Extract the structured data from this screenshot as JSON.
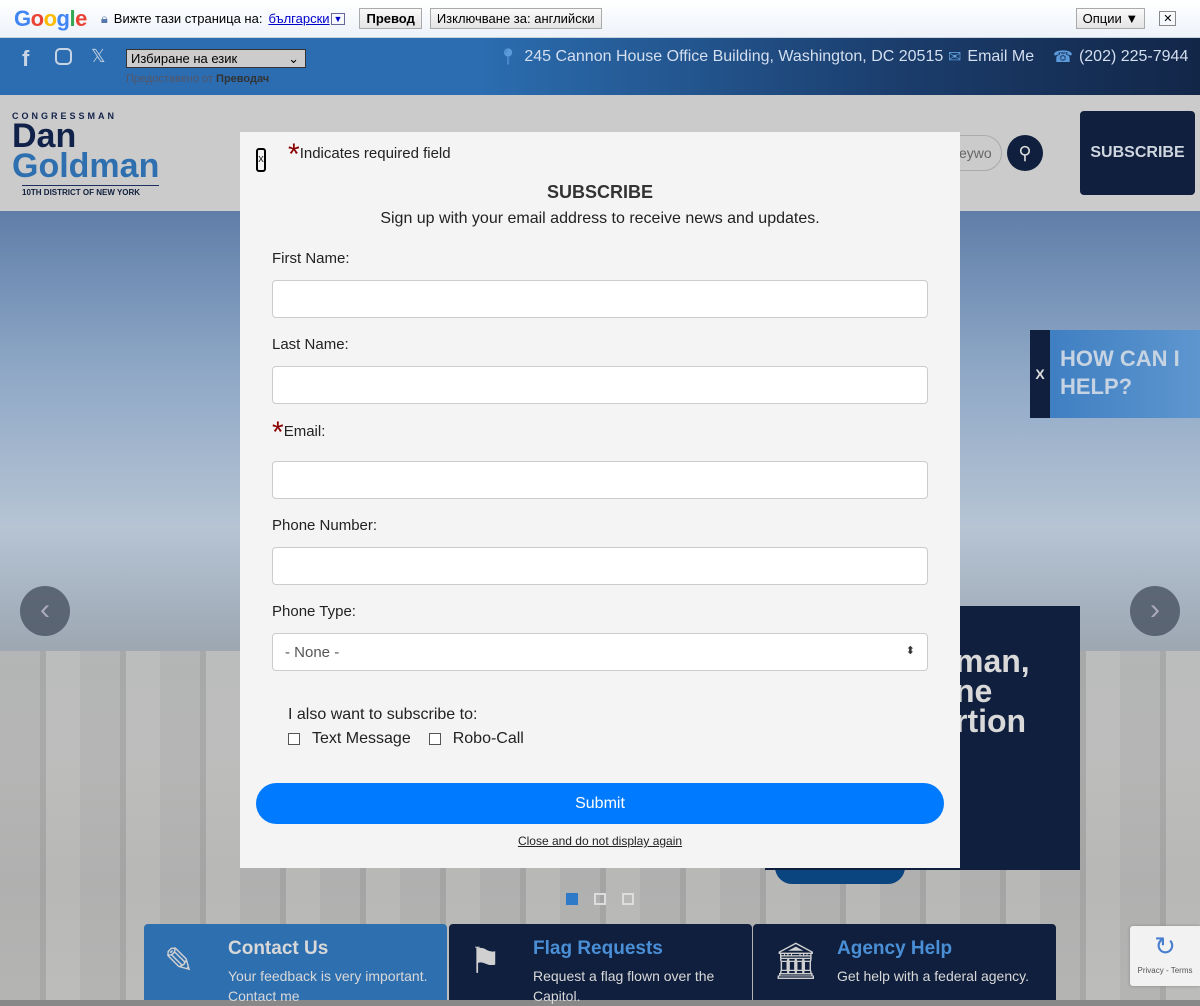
{
  "translate_bar": {
    "logo": "Google",
    "prompt": "Вижте тази страница на:",
    "language": "български",
    "translate": "Превод",
    "disable": "Изключване за: английски",
    "options": "Опции ▼",
    "close": "✕"
  },
  "topbar": {
    "social": [
      "facebook",
      "instagram",
      "x"
    ],
    "language_select": "Избиране на език",
    "powered_by": "Предоставено от",
    "powered_brand": "Преводач",
    "address": "245 Cannon House Office Building, Washington, DC 20515",
    "email": "Email Me",
    "phone": "(202) 225-7944"
  },
  "header": {
    "logo": {
      "line1": "CONGRESSMAN",
      "line2": "Dan",
      "line3": "Goldman",
      "line4": "10TH DISTRICT OF NEW YORK"
    },
    "search_placeholder": "eywo",
    "subscribe": "SUBSCRIBE"
  },
  "hero": {
    "slide_text": [
      "man,",
      "ne",
      "rtion"
    ],
    "dots": 3,
    "active_dot": 0
  },
  "help_widget": {
    "close": "X",
    "label": "HOW CAN I HELP?"
  },
  "cards": [
    {
      "title": "Contact Us",
      "text": "Your feedback is very important. Contact me",
      "color": "#2e6fb0"
    },
    {
      "title": "Flag Requests",
      "text": "Request a flag flown over the Capitol.",
      "color": "#0f1f3d"
    },
    {
      "title": "Agency Help",
      "text": "Get help with a federal agency.",
      "color": "#0f1f3d"
    }
  ],
  "recaptcha": {
    "text": "Privacy - Terms"
  },
  "modal": {
    "close": "x",
    "required_note": "Indicates required field",
    "title": "SUBSCRIBE",
    "subtitle": "Sign up with your email address to receive news and updates.",
    "first_name": "First Name:",
    "last_name": "Last Name:",
    "email": "Email:",
    "phone": "Phone Number:",
    "phone_type": "Phone Type:",
    "phone_type_value": "- None -",
    "also": "I also want to subscribe to:",
    "opt1": "Text Message",
    "opt2": "Robo-Call",
    "submit": "Submit",
    "never": "Close and do not display again"
  }
}
